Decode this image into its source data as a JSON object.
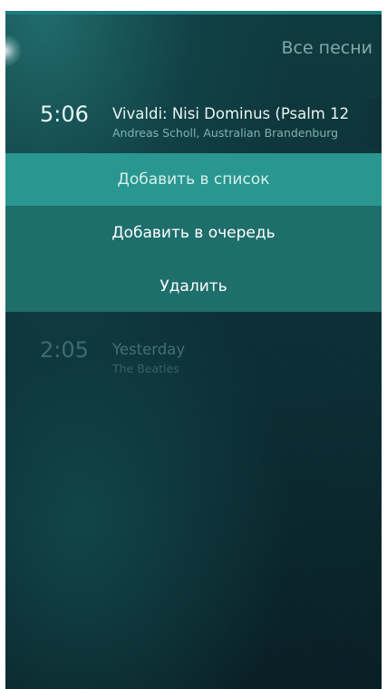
{
  "header": {
    "title": "Все песни"
  },
  "songs": [
    {
      "duration": "5:06",
      "title": "Vivaldi: Nisi Dominus (Psalm 12",
      "artist": "Andreas Scholl, Australian Brandenburg"
    },
    {
      "duration": "2:05",
      "title": "Yesterday",
      "artist": "The Beatles"
    }
  ],
  "context_menu": {
    "items": [
      {
        "label": "Добавить в список",
        "selected": true
      },
      {
        "label": "Добавить в очередь",
        "selected": false
      },
      {
        "label": "Удалить",
        "selected": false
      }
    ]
  },
  "colors": {
    "accent_selected": "#2a9690",
    "menu_background": "#1e6e6b",
    "background_dark": "#0a2c33"
  }
}
